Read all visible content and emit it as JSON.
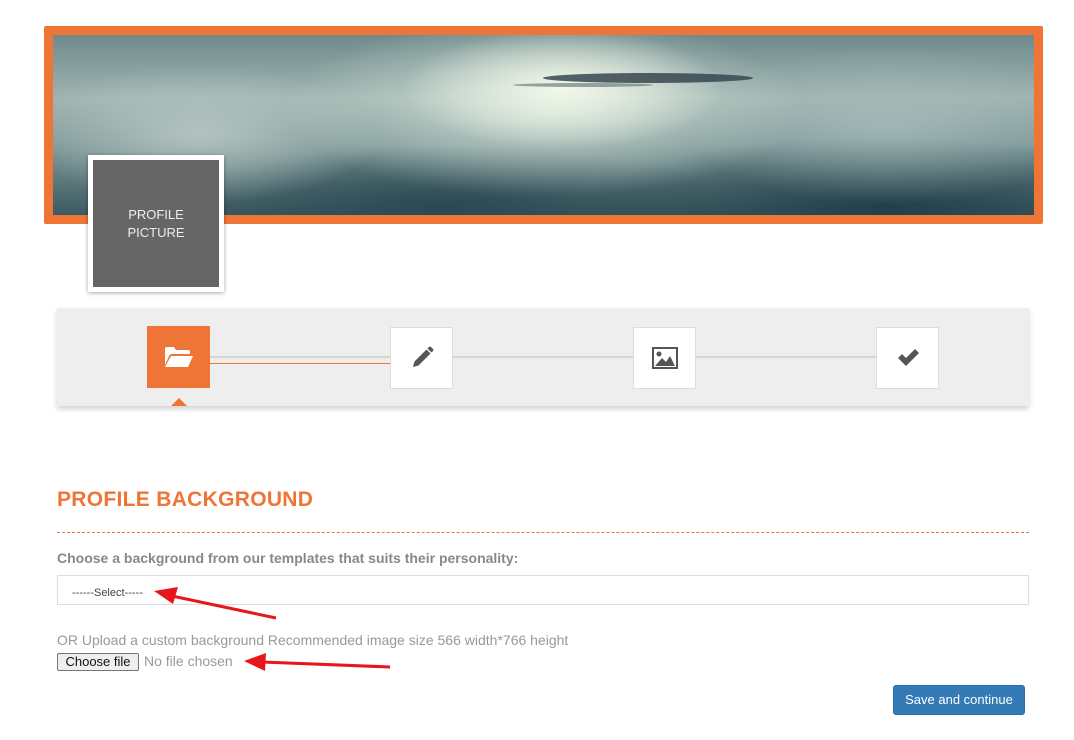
{
  "profile_picture": {
    "label": "PROFILE PICTURE"
  },
  "wizard": {
    "steps": [
      {
        "icon": "folder-open-icon",
        "state": "active"
      },
      {
        "icon": "pencil-icon",
        "state": "pending"
      },
      {
        "icon": "image-icon",
        "state": "pending"
      },
      {
        "icon": "checkmark-icon",
        "state": "pending"
      }
    ]
  },
  "section": {
    "title": "PROFILE BACKGROUND",
    "choose_label": "Choose a background from our templates that suits their personality:",
    "select_value": "------Select-----",
    "upload_label": "OR Upload a custom background Recommended image size 566 width*766 height",
    "file_button": "Choose file",
    "file_status": "No file chosen",
    "save_button": "Save and continue"
  },
  "colors": {
    "accent": "#ee7536",
    "primary_button": "#337ab7",
    "annotation_arrow": "#e8161a"
  }
}
